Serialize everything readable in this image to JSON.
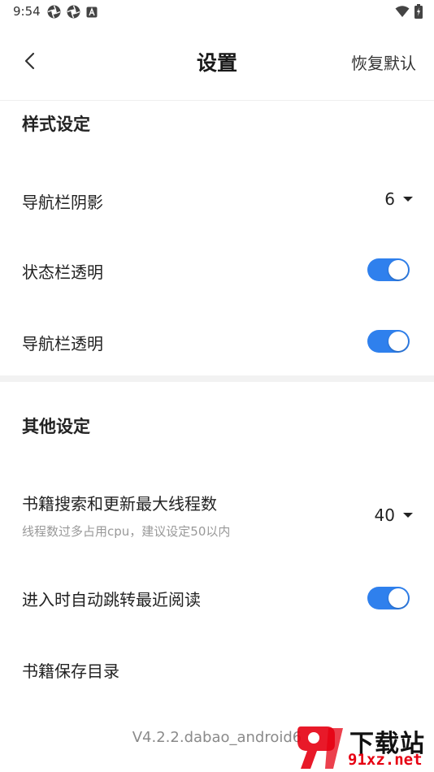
{
  "status": {
    "time": "9:54"
  },
  "header": {
    "title": "设置",
    "restore_label": "恢复默认"
  },
  "sections": {
    "style": {
      "title": "样式设定",
      "nav_shadow": {
        "label": "导航栏阴影",
        "value": "6"
      },
      "status_transparent": {
        "label": "状态栏透明",
        "on": true
      },
      "nav_transparent": {
        "label": "导航栏透明",
        "on": true
      }
    },
    "other": {
      "title": "其他设定",
      "threads": {
        "label": "书籍搜索和更新最大线程数",
        "sub": "线程数过多占用cpu，建议设定50以内",
        "value": "40"
      },
      "auto_jump": {
        "label": "进入时自动跳转最近阅读",
        "on": true
      },
      "save_dir": {
        "label": "书籍保存目录"
      }
    }
  },
  "footer": {
    "version": "V4.2.2.dabao_android6"
  },
  "watermark": {
    "text": "下载站",
    "url": "91xz.net"
  },
  "colors": {
    "accent": "#2f80ed",
    "watermark_red": "#e60012"
  }
}
